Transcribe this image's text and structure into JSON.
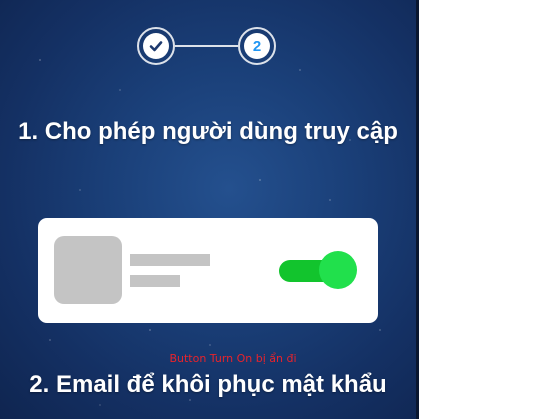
{
  "stepper": {
    "step1_state": "completed",
    "step2_label": "2"
  },
  "sections": {
    "allow_access_title": "1. Cho phép người dùng truy cập",
    "recovery_email_title": "2. Email để khôi phục mật khẩu"
  },
  "illustration": {
    "toggle_state": "on"
  },
  "annotation": "Button Turn On bị ẩn đi",
  "colors": {
    "background": "#1a3f78",
    "step_active": "#2196f3",
    "toggle_on": "#21e04c",
    "annotation": "#e8232b"
  }
}
